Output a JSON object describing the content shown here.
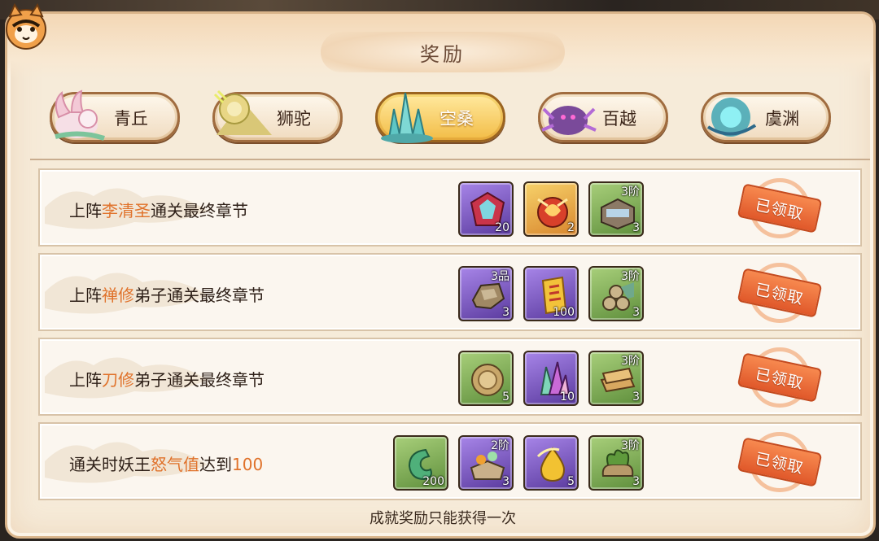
{
  "window": {
    "title": "奖励"
  },
  "colors": {
    "accent_text": "#e0722b",
    "active_tab": "#f3bf4b",
    "claimed_stamp": "#e0582a"
  },
  "tabs": [
    {
      "label": "青丘",
      "icon": "fox-icon",
      "active": false
    },
    {
      "label": "狮驼",
      "icon": "lion-icon",
      "active": false
    },
    {
      "label": "空桑",
      "icon": "crystal-icon",
      "active": true
    },
    {
      "label": "百越",
      "icon": "spider-icon",
      "active": false
    },
    {
      "label": "虞渊",
      "icon": "orb-icon",
      "active": false
    }
  ],
  "achievements": [
    {
      "task_prefix": "上阵",
      "task_highlight": "李清圣",
      "task_suffix": "通关最终章节",
      "status": "已领取",
      "rewards": [
        {
          "icon": "gem-shield-icon",
          "quantity": "20",
          "tier": ""
        },
        {
          "icon": "fire-orb-icon",
          "quantity": "2",
          "tier": ""
        },
        {
          "icon": "crate-icon",
          "quantity": "3",
          "tier": "3阶"
        }
      ]
    },
    {
      "task_prefix": "上阵",
      "task_highlight": "禅修",
      "task_suffix": "弟子通关最终章节",
      "status": "已领取",
      "rewards": [
        {
          "icon": "ore-icon",
          "quantity": "3",
          "tier": "3品"
        },
        {
          "icon": "talisman-icon",
          "quantity": "100",
          "tier": ""
        },
        {
          "icon": "logs-icon",
          "quantity": "3",
          "tier": "3阶"
        }
      ]
    },
    {
      "task_prefix": "上阵",
      "task_highlight": "刀修",
      "task_suffix": "弟子通关最终章节",
      "status": "已领取",
      "rewards": [
        {
          "icon": "coin-icon",
          "quantity": "5",
          "tier": ""
        },
        {
          "icon": "crystal-shard-icon",
          "quantity": "10",
          "tier": ""
        },
        {
          "icon": "money-stack-icon",
          "quantity": "3",
          "tier": "3阶"
        }
      ]
    },
    {
      "task_prefix": "通关时妖王",
      "task_highlight": "怒气值",
      "task_mid": "达到",
      "task_number": "100",
      "status": "已领取",
      "rewards": [
        {
          "icon": "jade-icon",
          "quantity": "200",
          "tier": ""
        },
        {
          "icon": "flower-chest-icon",
          "quantity": "3",
          "tier": "2阶"
        },
        {
          "icon": "golden-drop-icon",
          "quantity": "5",
          "tier": ""
        },
        {
          "icon": "herb-bag-icon",
          "quantity": "3",
          "tier": "3阶"
        }
      ]
    }
  ],
  "footer": {
    "note": "成就奖励只能获得一次"
  }
}
